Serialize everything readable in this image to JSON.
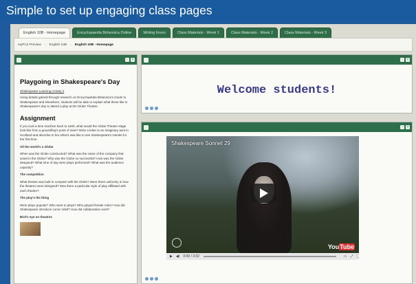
{
  "banner": {
    "text": "Simple to set up engaging class pages"
  },
  "tabs": [
    {
      "label": "English 10B - Homepage"
    },
    {
      "label": "Encyclopaedia Britannica Online"
    },
    {
      "label": "Writing forum"
    },
    {
      "label": "Class Materials - Week 1"
    },
    {
      "label": "Class Materials - Week 2"
    },
    {
      "label": "Class Materials - Week 3"
    }
  ],
  "breadcrumb": [
    {
      "label": "myPLS Preview"
    },
    {
      "label": "English 10B"
    },
    {
      "label": "English 10B - Homepage"
    }
  ],
  "left_panel": {
    "title": "Playgoing in Shakespeare's Day",
    "link": "Shakespeare Learning Activity 2",
    "intro": "Using details gained through research on Encyclopædia Britannica's Guide to Shakespeare and elsewhere, students will be able to explain what these like in Shakespeare's day to attend a play at the Globe Theatre.",
    "assignment_heading": "Assignment",
    "assignment_text": "If you took a time machine back to 1600, what would the Globe Theatre stage look like from a groundling's point of view? Write a letter to an imaginary aunt in Scotland and describe to her what it was like to see Shakespeare's Hamlet for the first time.",
    "sections": [
      {
        "heading": "All the world's a Globe",
        "text": "When was the Globe constructed? What was the name of the company that acted in the Globe? Why was the Globe so successful? How was the Globe designed? What time of day were plays performed? What was the audience capacity?"
      },
      {
        "heading": "The competition",
        "text": "What theatre was built to compete with the Globe? Were there uniformly in how the theatres were designed? Was there a particular style of play affiliated with each theatre?"
      },
      {
        "heading": "The play's the thing",
        "text": "Were plays popular? Who went to plays? Who played female roles? How did Shakespeare introduce comic relief? How did collaboration work?"
      },
      {
        "heading": "Bird's eye on theatres",
        "text": ""
      }
    ]
  },
  "welcome_panel": {
    "text": "Welcome students!"
  },
  "video": {
    "title": "Shakespeare Sonnet 29",
    "time": "0:00 / 3:02",
    "brand_you": "You",
    "brand_tube": "Tube"
  }
}
